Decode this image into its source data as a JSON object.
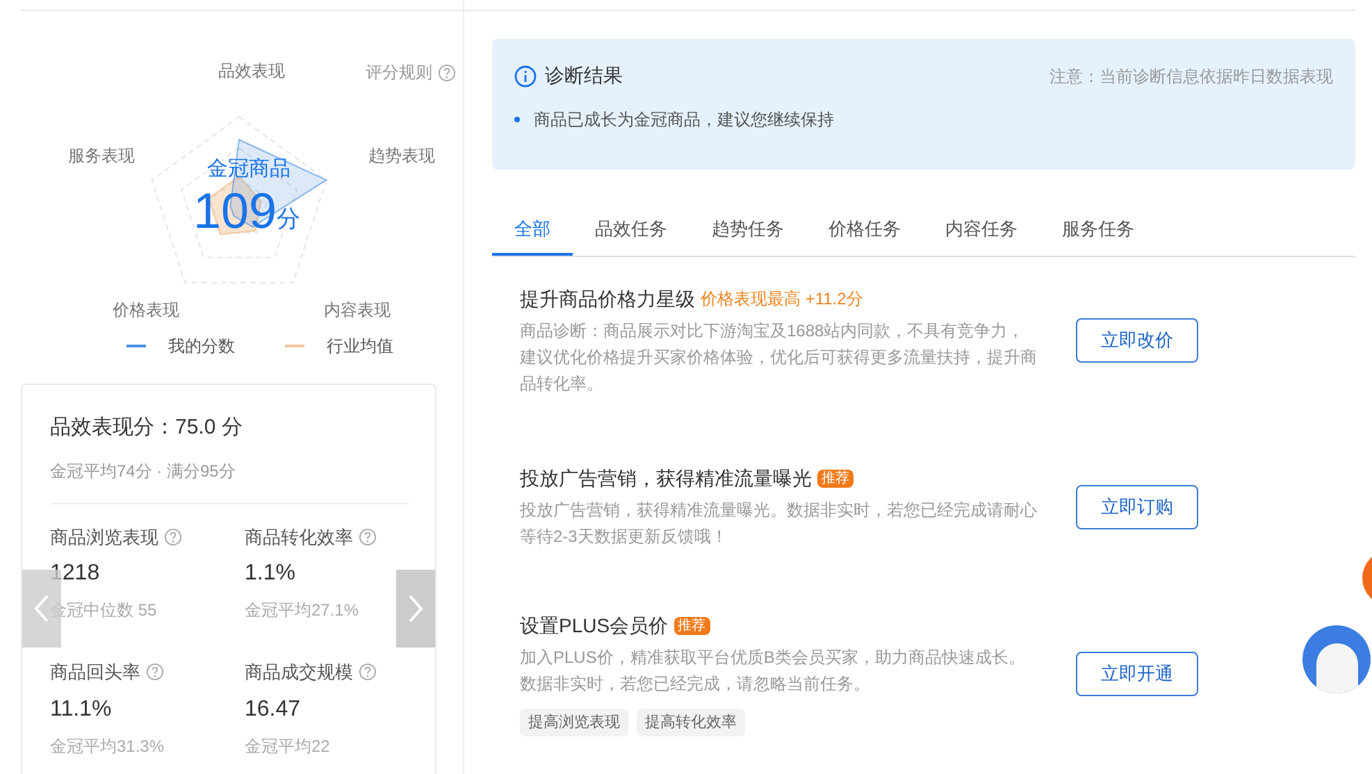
{
  "radar": {
    "axes": [
      "品效表现",
      "趋势表现",
      "内容表现",
      "价格表现",
      "服务表现"
    ],
    "rule_link": "评分规则",
    "grade": "金冠商品",
    "score": "109",
    "score_unit": "分",
    "legend": [
      {
        "label": "我的分数",
        "color": "#4a90e2"
      },
      {
        "label": "行业均值",
        "color": "#f5c9a0"
      }
    ]
  },
  "score_card": {
    "title": "品效表现分：75.0 分",
    "subtitle": "金冠平均74分 · 满分95分",
    "metrics": [
      {
        "label": "商品浏览表现",
        "value": "1218",
        "note": "金冠中位数 55"
      },
      {
        "label": "商品转化效率",
        "value": "1.1%",
        "note": "金冠平均27.1%"
      },
      {
        "label": "商品回头率",
        "value": "11.1%",
        "note": "金冠平均31.3%"
      },
      {
        "label": "商品成交规模",
        "value": "16.47",
        "note": "金冠平均22"
      }
    ]
  },
  "diagnosis": {
    "title": "诊断结果",
    "notice": "注意：当前诊断信息依据昨日数据表现",
    "items": [
      "商品已成长为金冠商品，建议您继续保持"
    ]
  },
  "tabs": [
    {
      "label": "全部",
      "selected": true
    },
    {
      "label": "品效任务",
      "selected": false
    },
    {
      "label": "趋势任务",
      "selected": false
    },
    {
      "label": "价格任务",
      "selected": false
    },
    {
      "label": "内容任务",
      "selected": false
    },
    {
      "label": "服务任务",
      "selected": false
    }
  ],
  "tasks": [
    {
      "title": "提升商品价格力星级",
      "highlight": "价格表现最高 +11.2分",
      "description": "商品诊断：商品展示对比下游淘宝及1688站内同款，不具有竞争力，建议优化价格提升买家价格体验，优化后可获得更多流量扶持，提升商品转化率。",
      "button": "立即改价"
    },
    {
      "title": "投放广告营销，获得精准流量曝光",
      "badge": "推荐",
      "description": "投放广告营销，获得精准流量曝光。数据非实时，若您已经完成请耐心等待2-3天数据更新反馈哦！",
      "button": "立即订购"
    },
    {
      "title": "设置PLUS会员价",
      "badge": "推荐",
      "description": "加入PLUS价，精准获取平台优质B类会员买家，助力商品快速成长。数据非实时，若您已经完成，请忽略当前任务。",
      "tags": [
        "提高浏览表现",
        "提高转化效率"
      ],
      "button": "立即开通"
    }
  ]
}
